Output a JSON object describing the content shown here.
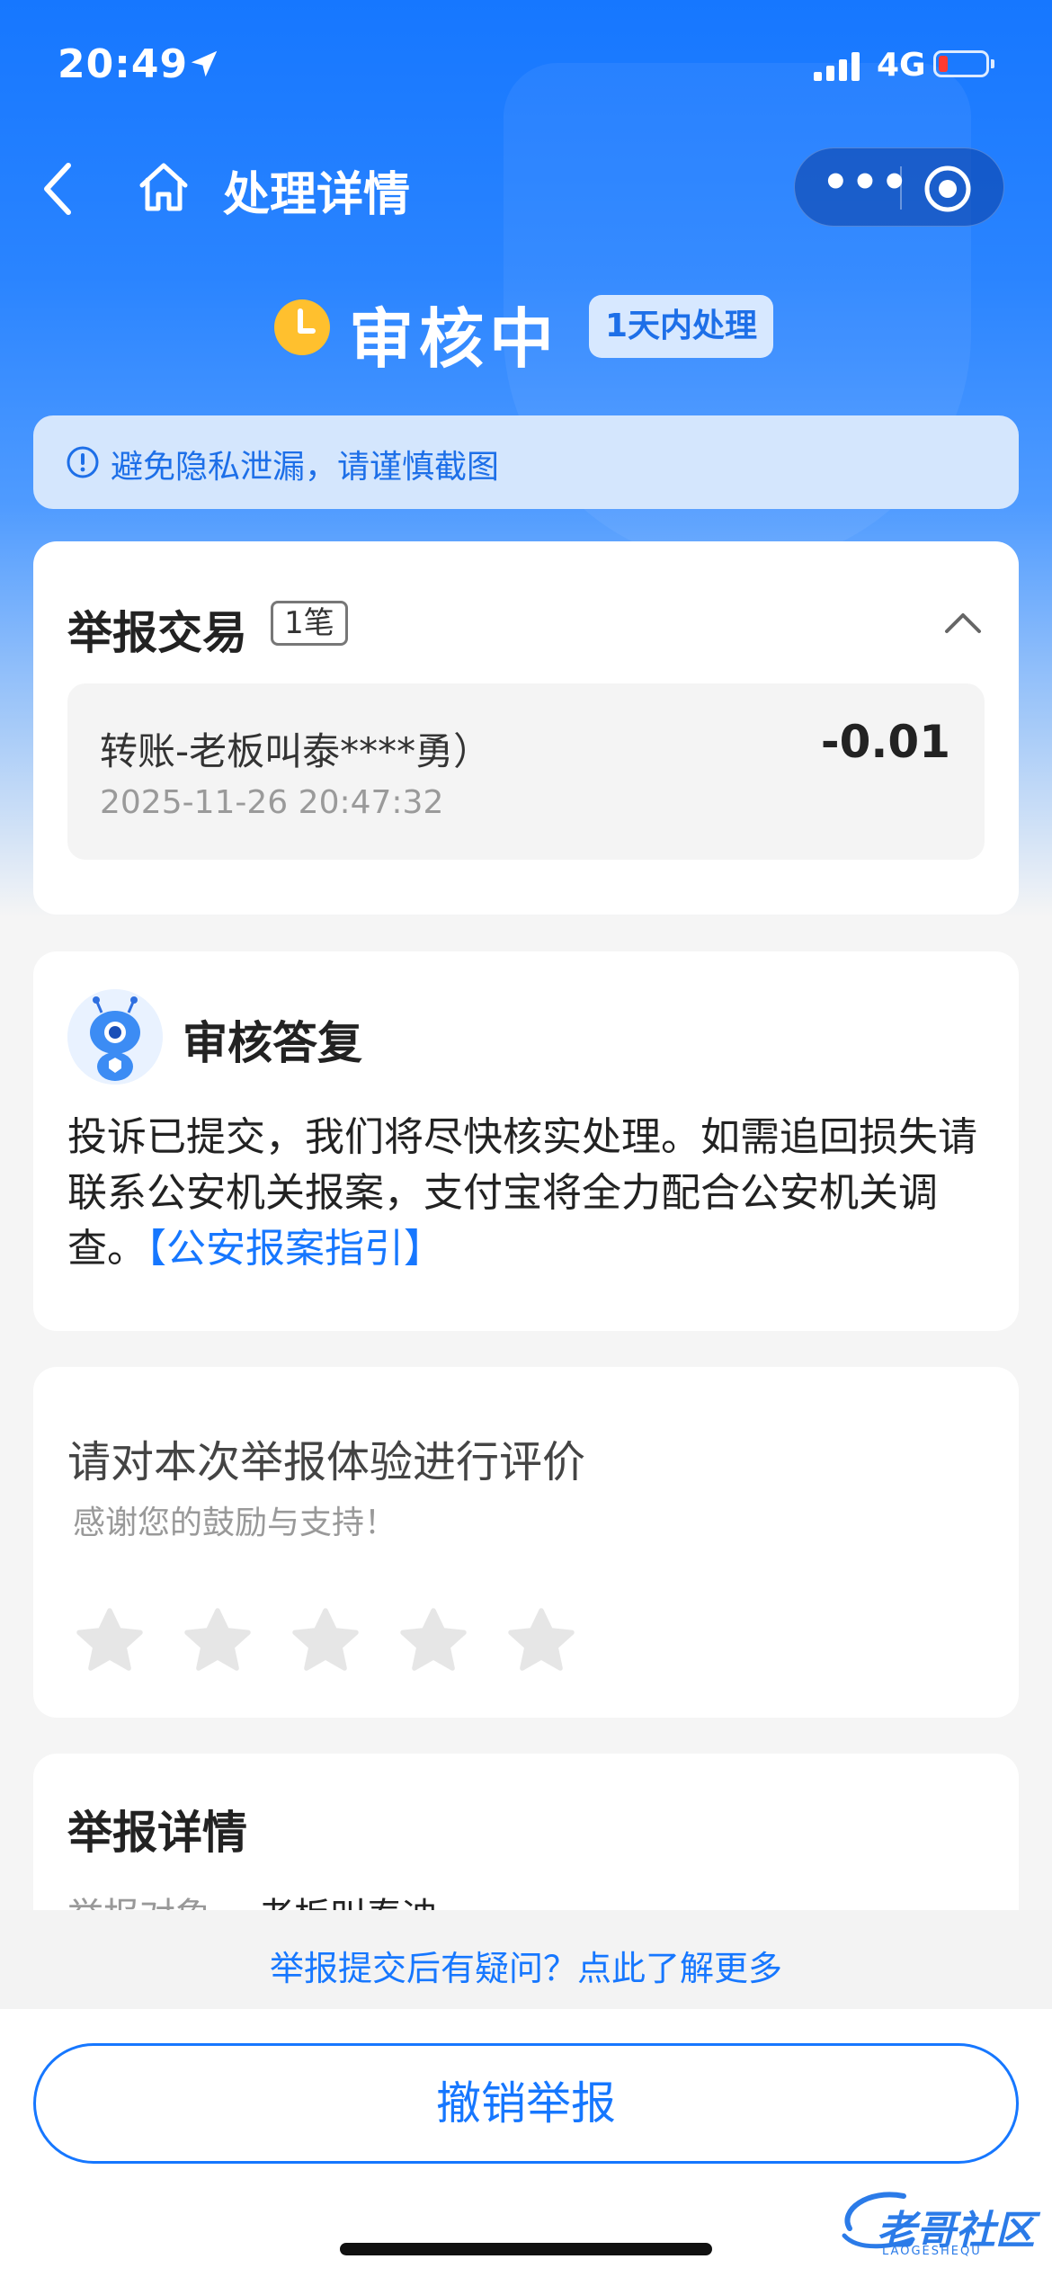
{
  "status_bar": {
    "time": "20:49",
    "network": "4G"
  },
  "nav": {
    "title": "处理详情"
  },
  "status": {
    "state": "审核中",
    "time_badge": "1天内处理"
  },
  "notice": {
    "text": "避免隐私泄漏，请谨慎截图"
  },
  "reported_transactions": {
    "title": "举报交易",
    "count": "1笔",
    "items": [
      {
        "name": "转账-老板叫泰****勇）",
        "amount": "-0.01",
        "datetime": "2025-11-26 20:47:32"
      }
    ]
  },
  "review_reply": {
    "title": "审核答复",
    "body": "投诉已提交，我们将尽快核实处理。如需追回损失请联系公安机关报案，支付宝将全力配合公安机关调查。",
    "link": "【公安报案指引】"
  },
  "rating": {
    "title": "请对本次举报体验进行评价",
    "subtitle": "感谢您的鼓励与支持！",
    "max_stars": 5,
    "value": 0
  },
  "report_details": {
    "title": "举报详情",
    "rows": [
      {
        "label": "举报对象",
        "value": "老板叫泰迪"
      }
    ]
  },
  "footer": {
    "faq_link": "举报提交后有疑问？点此了解更多",
    "cancel_button": "撤销举报"
  },
  "watermark": {
    "text": "老哥社区",
    "sub": "LAOGESHEQU"
  },
  "colors": {
    "brand_blue": "#1677ff",
    "warning_yellow": "#ffc02e"
  }
}
